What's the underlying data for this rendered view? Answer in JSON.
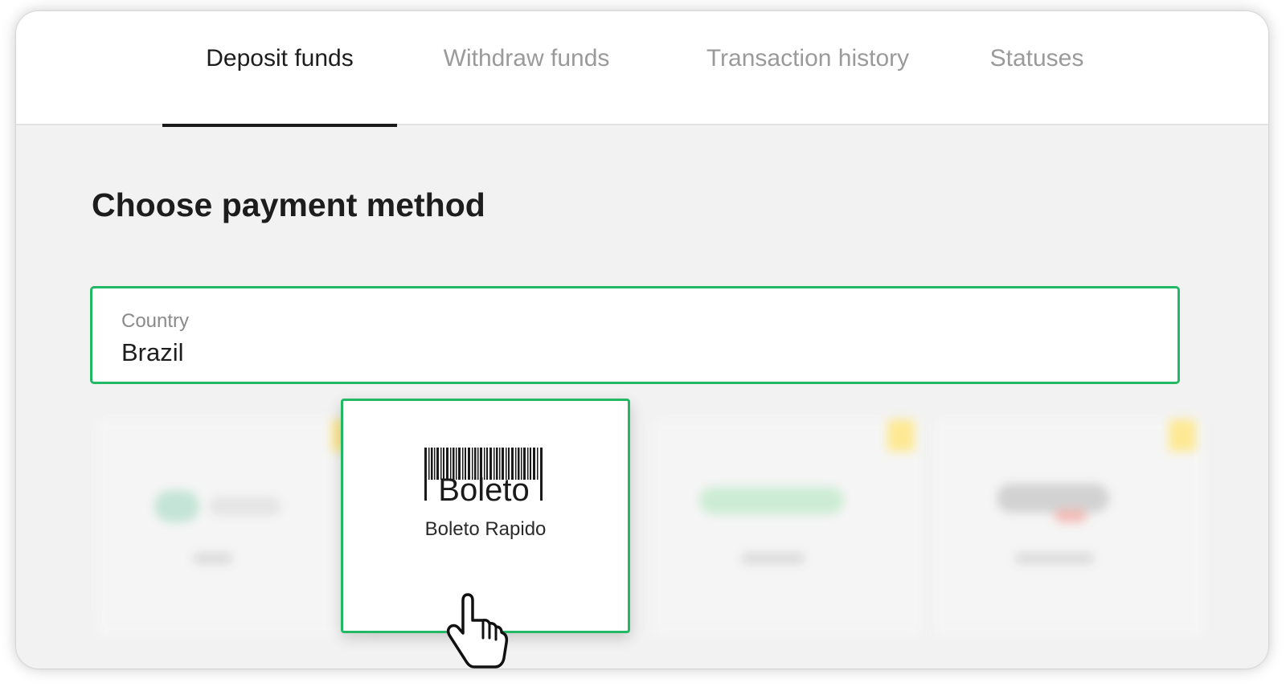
{
  "tabs": [
    {
      "label": "Deposit funds",
      "active": true
    },
    {
      "label": "Withdraw funds",
      "active": false
    },
    {
      "label": "Transaction history",
      "active": false
    },
    {
      "label": "Statuses",
      "active": false
    }
  ],
  "heading": "Choose payment method",
  "country": {
    "label": "Country",
    "value": "Brazil"
  },
  "selected_method": {
    "logo_text": "Boleto",
    "label": "Boleto Rapido",
    "icon": "barcode-logo"
  },
  "colors": {
    "accent_green": "#22b864",
    "active_tab_underline": "#1a1a1a",
    "badge_yellow": "#ffe98a"
  },
  "cursor": {
    "icon": "hand-pointer-icon"
  }
}
